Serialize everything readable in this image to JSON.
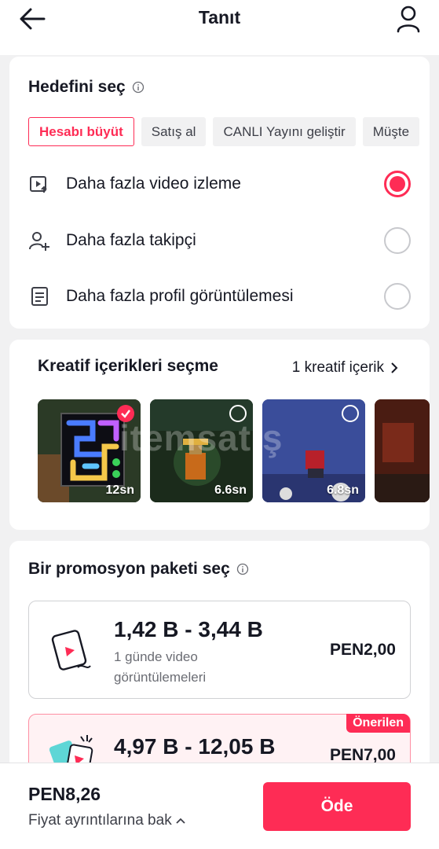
{
  "header": {
    "title": "Tanıt",
    "back_icon": "arrow-left-icon",
    "profile_icon": "person-icon"
  },
  "goal": {
    "title": "Hedefini seç",
    "chips": [
      "Hesabı büyüt",
      "Satış al",
      "CANLI Yayını geliştir",
      "Müşte"
    ],
    "selected_chip": "Hesabı büyüt",
    "options": [
      {
        "label": "Daha fazla video izleme",
        "icon": "video-play-icon",
        "selected": true
      },
      {
        "label": "Daha fazla takipçi",
        "icon": "person-add-icon",
        "selected": false
      },
      {
        "label": "Daha fazla profil görüntülemesi",
        "icon": "profile-page-icon",
        "selected": false
      }
    ]
  },
  "creative": {
    "title": "Kreatif içerikleri seçme",
    "count_label": "1 kreatif içerik",
    "thumbnails": [
      {
        "duration": "12sn",
        "selected": true
      },
      {
        "duration": "6.6sn",
        "selected": false
      },
      {
        "duration": "6.8sn",
        "selected": false
      },
      {
        "duration": "",
        "selected": false
      }
    ],
    "watermark": "itemsatış"
  },
  "package": {
    "title": "Bir promosyon paketi seç",
    "items": [
      {
        "range": "1,42 B - 3,44 B",
        "desc": "1 günde video görüntülemeleri",
        "price": "PEN2,00",
        "badge": ""
      },
      {
        "range": "4,97 B - 12,05 B",
        "desc": "",
        "price": "PEN7,00",
        "badge": "Önerilen"
      }
    ]
  },
  "footer": {
    "total": "PEN8,26",
    "details_label": "Fiyat ayrıntılarına bak",
    "pay_label": "Öde"
  },
  "colors": {
    "accent": "#fe2c55",
    "background": "#f1f1f2",
    "text": "#161823"
  }
}
